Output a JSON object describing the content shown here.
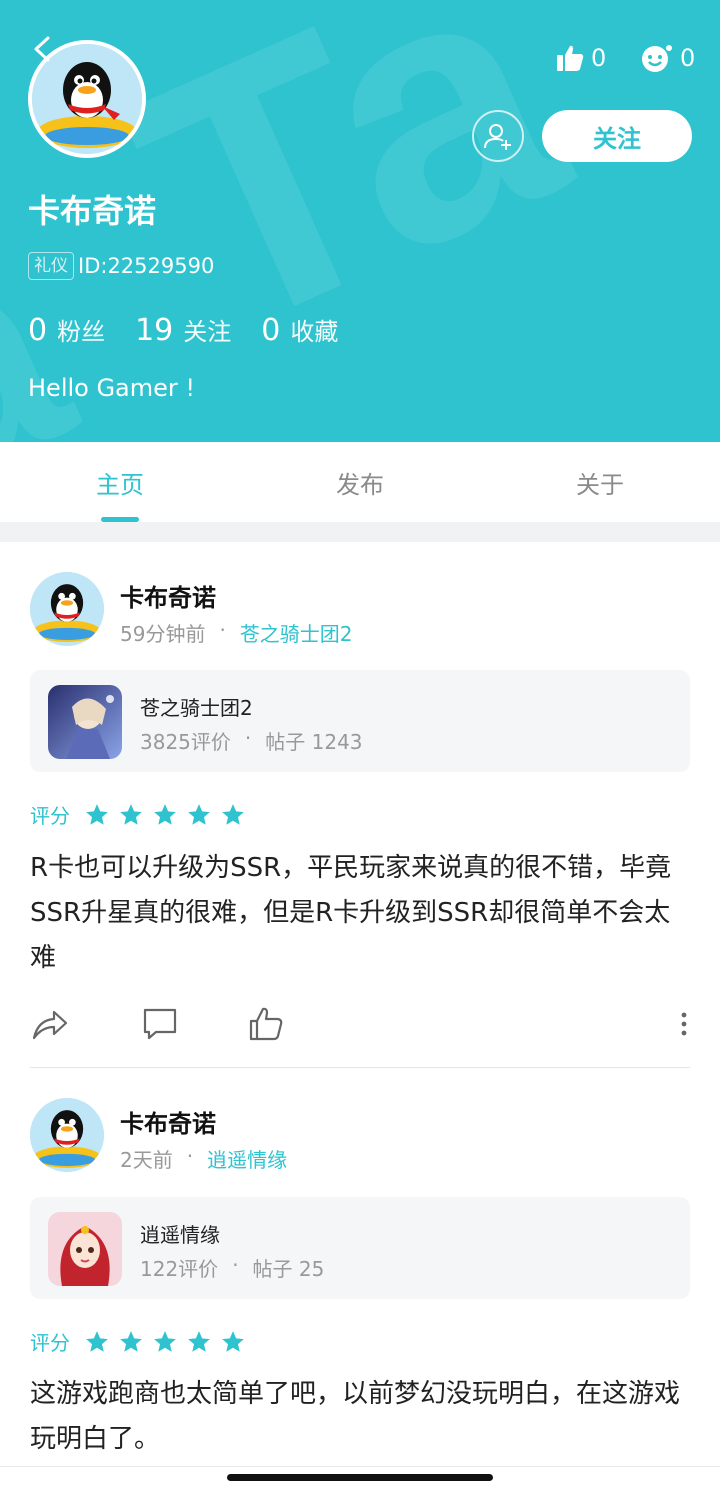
{
  "profile": {
    "name": "卡布奇诺",
    "badge": "礼仪",
    "id_text": "ID:22529590",
    "likes_count": "0",
    "emoji_count": "0",
    "follow_label": "关注",
    "bio": "Hello Gamer !",
    "stats": [
      {
        "num": "0",
        "label": "粉丝"
      },
      {
        "num": "19",
        "label": "关注"
      },
      {
        "num": "0",
        "label": "收藏"
      }
    ]
  },
  "tabs": [
    {
      "label": "主页",
      "active": true
    },
    {
      "label": "发布",
      "active": false
    },
    {
      "label": "关于",
      "active": false
    }
  ],
  "posts": [
    {
      "author": "卡布奇诺",
      "time": "59分钟前",
      "game": "苍之骑士团2",
      "card": {
        "title": "苍之骑士团2",
        "reviews": "3825评价",
        "posts": "帖子 1243"
      },
      "rating_label": "评分",
      "stars": 5,
      "text": "R卡也可以升级为SSR，平民玩家来说真的很不错，毕竟SSR升星真的很难，但是R卡升级到SSR却很简单不会太难"
    },
    {
      "author": "卡布奇诺",
      "time": "2天前",
      "game": "逍遥情缘",
      "card": {
        "title": "逍遥情缘",
        "reviews": "122评价",
        "posts": "帖子 25"
      },
      "rating_label": "评分",
      "stars": 5,
      "text": "这游戏跑商也太简单了吧，以前梦幻没玩明白，在这游戏玩明白了。"
    }
  ],
  "colors": {
    "accent": "#2ec3cf",
    "header_bg": "#2ec3cf",
    "star": "#2ec3cf"
  },
  "icons": [
    "back-icon",
    "thumb-up-icon",
    "emoji-icon",
    "add-friend-icon",
    "share-icon",
    "comment-icon",
    "like-icon",
    "more-icon",
    "star-icon"
  ]
}
